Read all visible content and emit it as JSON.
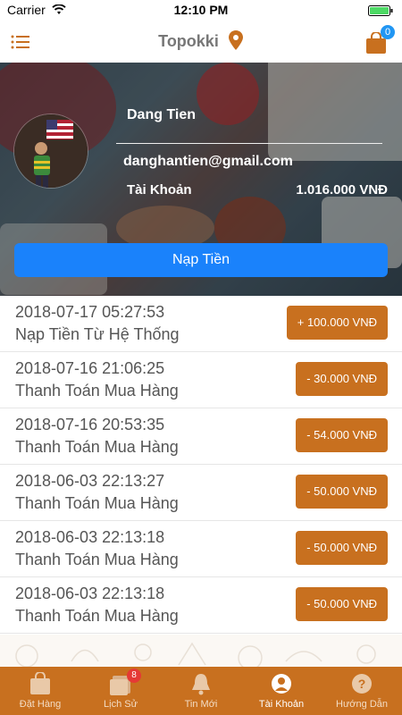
{
  "status_bar": {
    "carrier": "Carrier",
    "time": "12:10 PM"
  },
  "nav": {
    "title": "Topokki",
    "cart_count": "0"
  },
  "profile": {
    "name": "Dang Tien",
    "email": "danghantien@gmail.com",
    "account_label": "Tài Khoản",
    "balance": "1.016.000 VNĐ",
    "topup_label": "Nạp Tiền"
  },
  "transactions": [
    {
      "date": "2018-07-17 05:27:53",
      "desc": "Nạp Tiền Từ Hệ Thống",
      "amount": "+ 100.000 VNĐ"
    },
    {
      "date": "2018-07-16 21:06:25",
      "desc": "Thanh Toán Mua Hàng",
      "amount": "- 30.000 VNĐ"
    },
    {
      "date": "2018-07-16 20:53:35",
      "desc": "Thanh Toán Mua Hàng",
      "amount": "- 54.000 VNĐ"
    },
    {
      "date": "2018-06-03 22:13:27",
      "desc": "Thanh Toán Mua Hàng",
      "amount": "- 50.000 VNĐ"
    },
    {
      "date": "2018-06-03 22:13:18",
      "desc": "Thanh Toán Mua Hàng",
      "amount": "- 50.000 VNĐ"
    },
    {
      "date": "2018-06-03 22:13:18",
      "desc": "Thanh Toán Mua Hàng",
      "amount": "- 50.000 VNĐ"
    }
  ],
  "tabs": [
    {
      "label": "Đặt Hàng",
      "icon": "bag-icon"
    },
    {
      "label": "Lịch Sử",
      "icon": "history-icon",
      "badge": "8"
    },
    {
      "label": "Tin Mới",
      "icon": "bell-icon"
    },
    {
      "label": "Tài Khoản",
      "icon": "account-icon",
      "active": true
    },
    {
      "label": "Hướng Dẫn",
      "icon": "help-icon"
    }
  ],
  "colors": {
    "accent": "#c8701f",
    "primary_button": "#1a82fb",
    "badge_blue": "#2196f3",
    "badge_red": "#e53935"
  }
}
